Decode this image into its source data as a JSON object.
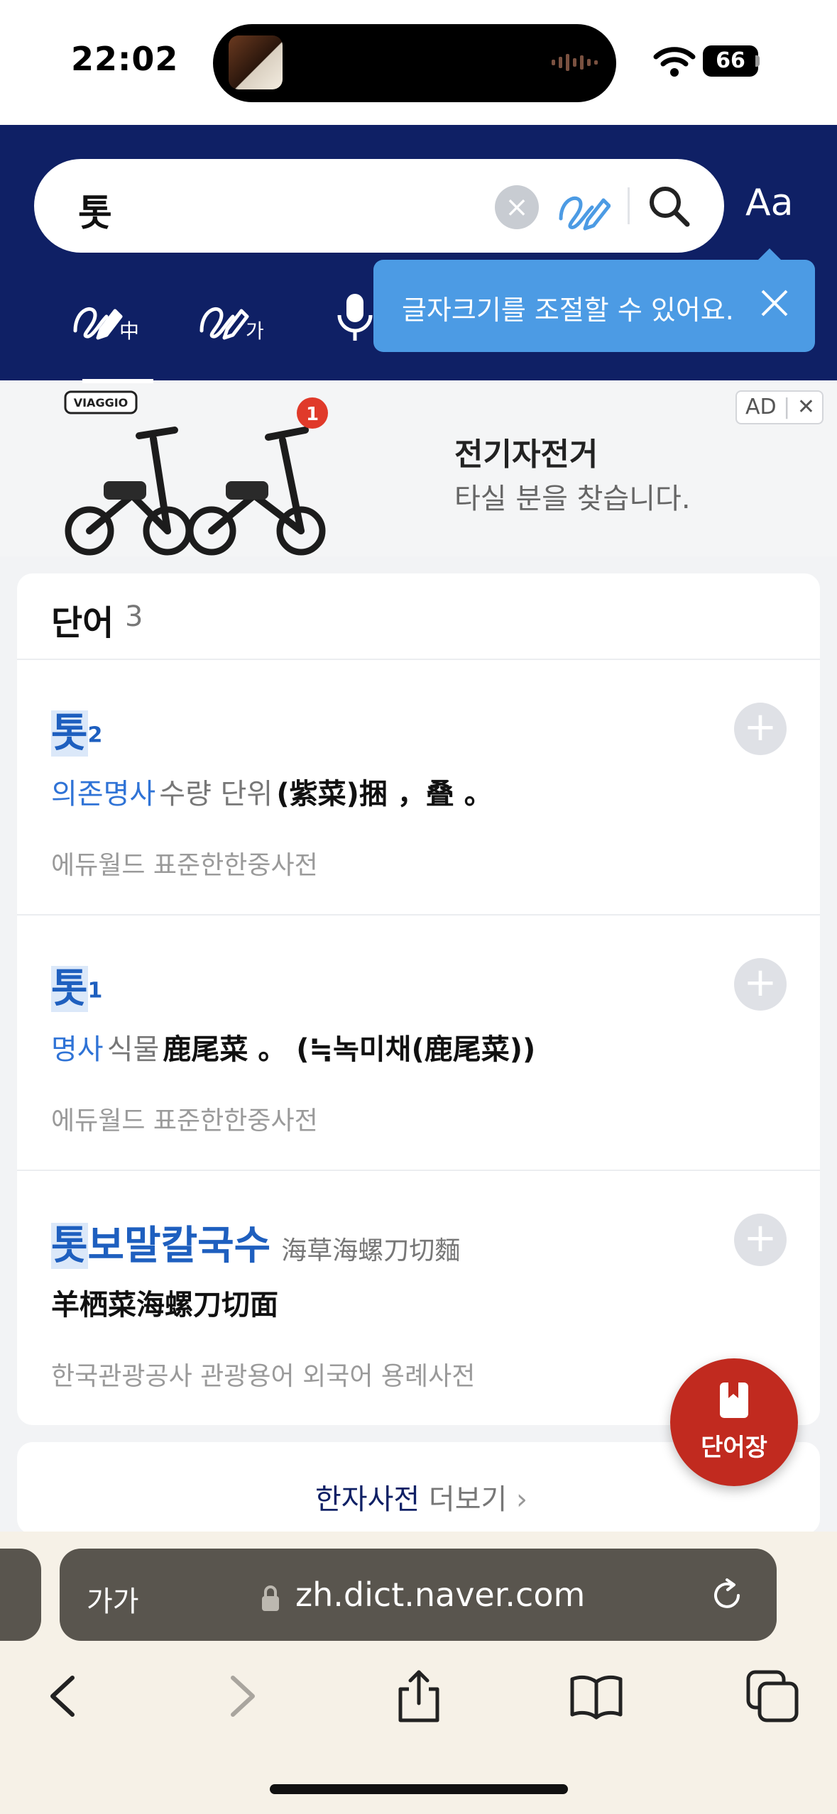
{
  "status": {
    "time": "22:02",
    "battery": "66"
  },
  "header": {
    "query": "톳",
    "font_size_button": "Aa",
    "tooltip": "글자크기를 조절할 수 있어요.",
    "tools": [
      {
        "glyph": "中"
      },
      {
        "glyph": "가"
      }
    ]
  },
  "ad": {
    "brand": "VIAGGIO",
    "badge": "1",
    "title": "전기자전거",
    "subtitle": "타실 분을 찾습니다.",
    "tag": "AD"
  },
  "results": {
    "heading": "단어",
    "count": "3",
    "entries": [
      {
        "word": "톳",
        "sup": "2",
        "pos": "의존명사",
        "sense": "수량 단위",
        "meaning": "(紫菜)捆 ，叠 。",
        "source": "에듀월드 표준한한중사전"
      },
      {
        "word": "톳",
        "sup": "1",
        "pos": "명사",
        "sense": "식물",
        "meaning": "鹿尾菜 。 (≒녹미채(鹿尾菜))",
        "source": "에듀월드 표준한한중사전"
      },
      {
        "word_hl": "톳",
        "word_rest": "보말칼국수",
        "hanja": "海草海螺刀切麵",
        "meaning": "羊栖菜海螺刀切面",
        "source": "한국관광공사 관광용어 외국어 용례사전"
      }
    ]
  },
  "more": {
    "strong": "한자사전",
    "rest": "더보기",
    "chevron": "›"
  },
  "fab": {
    "label": "단어장"
  },
  "browser": {
    "text_size": "가가",
    "url": "zh.dict.naver.com"
  },
  "colors": {
    "header_bg": "#0f2065",
    "accent": "#1e5fbf",
    "tooltip": "#4c9be4",
    "fab": "#c12a1f"
  }
}
